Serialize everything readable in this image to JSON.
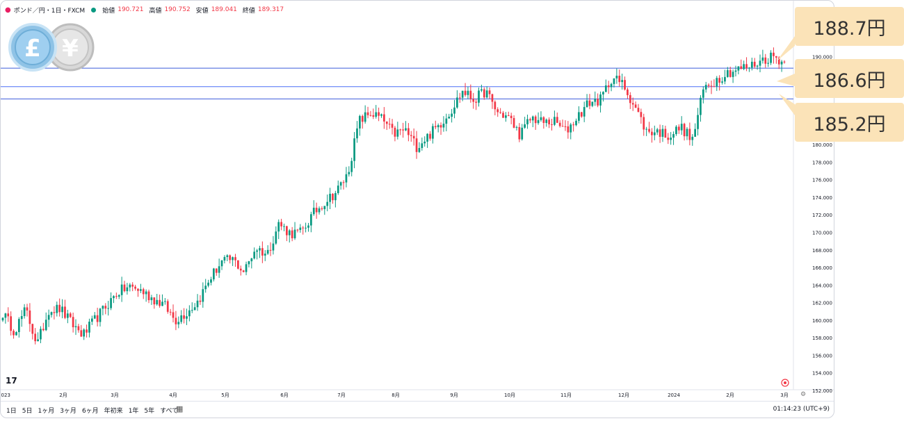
{
  "header": {
    "symbol": "ポンド／円・1日・FXCM",
    "open_label": "始値",
    "open_value": "190.721",
    "high_label": "高値",
    "high_value": "190.752",
    "low_label": "安値",
    "low_value": "189.041",
    "close_label": "終値",
    "close_value": "189.317"
  },
  "coins": {
    "pound": "£",
    "yen": "¥"
  },
  "callouts": [
    "188.7円",
    "186.6円",
    "185.2円"
  ],
  "bottom": {
    "ranges": [
      "1日",
      "5日",
      "1ヶ月",
      "3ヶ月",
      "6ヶ月",
      "年初来",
      "1年",
      "5年",
      "すべて"
    ],
    "clock": "01:14:23 (UTC+9)"
  },
  "logo": "17",
  "colors": {
    "up": "#089981",
    "down": "#f23645",
    "hline": "#2962ff",
    "callout": "#fbe3b8"
  },
  "chart_data": {
    "type": "candlestick",
    "ylim": [
      151.6,
      191.8
    ],
    "y_ticks": [
      "152.000",
      "154.000",
      "156.000",
      "158.000",
      "160.000",
      "162.000",
      "164.000",
      "166.000",
      "168.000",
      "170.000",
      "172.000",
      "174.000",
      "176.000",
      "178.000",
      "180.000",
      "190.000"
    ],
    "x_ticks": [
      "2023",
      "2月",
      "3月",
      "4月",
      "5月",
      "6月",
      "7月",
      "8月",
      "9月",
      "10月",
      "11月",
      "12月",
      "2024",
      "2月",
      "3月"
    ],
    "horizontal_lines": [
      188.7,
      186.6,
      185.2
    ],
    "close_path": [
      160.8,
      158.8,
      161.2,
      157.2,
      161.2,
      161.3,
      159.6,
      158.3,
      160.0,
      161.6,
      163.2,
      163.8,
      163.4,
      162.5,
      161.8,
      160.0,
      160.9,
      162.2,
      164.7,
      166.6,
      166.9,
      165.5,
      168.3,
      167.5,
      171.0,
      169.9,
      170.0,
      172.1,
      173.5,
      174.6,
      176.6,
      182.7,
      183.6,
      182.9,
      181.2,
      181.7,
      179.8,
      181.0,
      182.3,
      183.9,
      186.1,
      185.1,
      186.1,
      183.7,
      183.1,
      181.1,
      183.1,
      182.5,
      182.6,
      181.5,
      183.2,
      184.8,
      185.1,
      187.7,
      186.8,
      184.3,
      181.5,
      181.5,
      181.0,
      182.0,
      180.5,
      186.5,
      187.3,
      188.2,
      188.6,
      188.9,
      189.6,
      190.1,
      189.3
    ]
  }
}
